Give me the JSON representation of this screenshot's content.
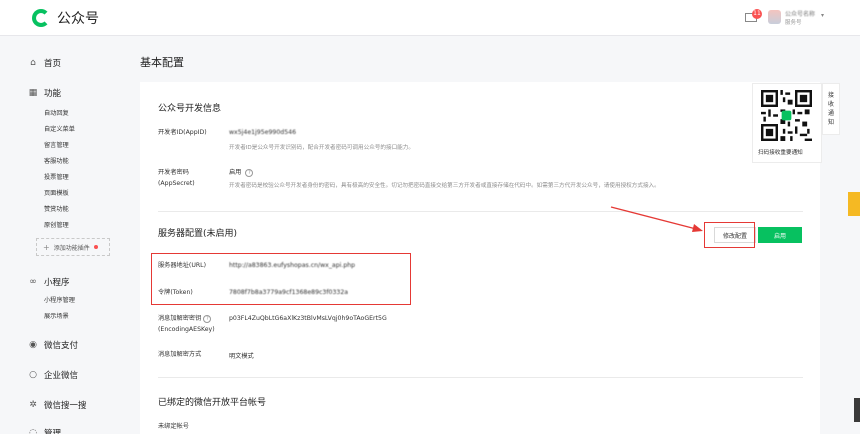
{
  "app": {
    "name": "公众号"
  },
  "header": {
    "mail_badge": "11",
    "account_name": "公众号名称",
    "account_type": "服务号"
  },
  "sidebar": {
    "home": "首页",
    "functions": "功能",
    "function_items": [
      "自动回复",
      "自定义菜单",
      "留言管理",
      "投票管理",
      "页面模板",
      "赞赏功能",
      "原创管理"
    ],
    "function_items_real": [
      "自动回复",
      "自定义菜单",
      "留言管理",
      "客服功能",
      "投票管理",
      "页面模板",
      "赞赏功能",
      "原创管理"
    ],
    "add_plugin": "添加功能插件",
    "miniprogram": "小程序",
    "miniprogram_items": [
      "小程序管理",
      "展示场景"
    ],
    "wechat_pay": "微信支付",
    "work_wechat": "企业微信",
    "search": "微信搜一搜",
    "manage": "管理"
  },
  "page": {
    "title": "基本配置"
  },
  "dev_info": {
    "section_title": "公众号开发信息",
    "appid_label": "开发者ID(AppID)",
    "appid_value": "wx5j4e1j95e990d546",
    "appid_desc": "开发者ID是公众号开发识别码，配合开发者密码可调用公众号的接口能力。",
    "secret_label_line1": "开发者密码",
    "secret_label_line2": "(AppSecret)",
    "secret_status": "启用",
    "secret_desc": "开发者密码是校验公众号开发者身份的密码，具有极高的安全性。切记勿把密码直接交给第三方开发者或直接存储在代码中。如需第三方代开发公众号，请使用授权方式接入。"
  },
  "server": {
    "section_title": "服务器配置(未启用)",
    "modify_button": "修改配置",
    "enable_button": "启用",
    "url_label": "服务器地址(URL)",
    "url_value": "http://a83863.eufyshopas.cn/wx_api.php",
    "token_label": "令牌(Token)",
    "token_value": "7808f7b8a3779a9cf1368e89c3f0332a",
    "aeskey_label_line1": "消息加解密密钥",
    "aeskey_label_line2": "(EncodingAESKey)",
    "aeskey_value": "p03FL4ZuQbLtG6aXlKz3tBlvMsLVqj0h9oTAoGErt5G",
    "encrypt_mode_label": "消息加解密方式",
    "encrypt_mode_value": "明文模式"
  },
  "open_platform": {
    "section_title": "已绑定的微信开放平台帐号",
    "unbound_label": "未绑定帐号"
  },
  "qr_panel": {
    "caption": "扫码接收重要通知"
  },
  "side_tab": {
    "chars": [
      "接",
      "收",
      "通",
      "知"
    ]
  },
  "colors": {
    "brand_green": "#07c160",
    "highlight_red": "#e53935",
    "badge_red": "#fa5151"
  }
}
